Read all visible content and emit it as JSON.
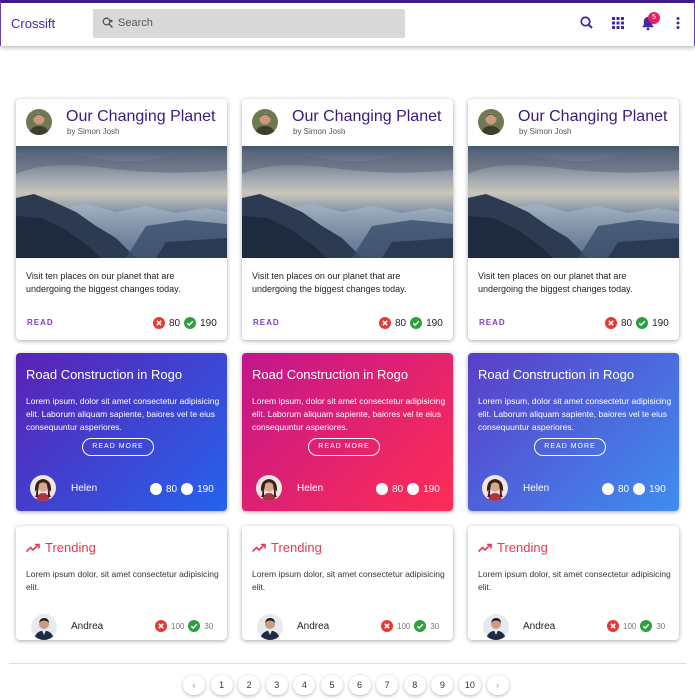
{
  "app": {
    "name": "Crossift"
  },
  "search": {
    "placeholder": "Search"
  },
  "notifications": {
    "count": "5"
  },
  "photo_cards": [
    {
      "title": "Our Changing Planet",
      "author": "by Simon Josh",
      "text": "Visit ten places on our planet that are undergoing the biggest changes today.",
      "action": "READ",
      "dislikes": "80",
      "likes": "190"
    },
    {
      "title": "Our Changing Planet",
      "author": "by Simon Josh",
      "text": "Visit ten places on our planet that are undergoing the biggest changes today.",
      "action": "READ",
      "dislikes": "80",
      "likes": "190"
    },
    {
      "title": "Our Changing Planet",
      "author": "by Simon Josh",
      "text": "Visit ten places on our planet that are undergoing the biggest changes today.",
      "action": "READ",
      "dislikes": "80",
      "likes": "190"
    }
  ],
  "gradient_cards": [
    {
      "title": "Road Construction in Rogo",
      "text": "Lorem ipsum, dolor sit amet consectetur adipisicing elit. Laborum aliquam sapiente, baiores vel te eius consequuntur asperiores.",
      "button": "READ MORE",
      "user": "Helen",
      "dislikes": "80",
      "likes": "190"
    },
    {
      "title": "Road Construction in Rogo",
      "text": "Lorem ipsum, dolor sit amet consectetur adipisicing elit. Laborum aliquam sapiente, baiores vel te eius consequuntur asperiores.",
      "button": "READ MORE",
      "user": "Helen",
      "dislikes": "80",
      "likes": "190"
    },
    {
      "title": "Road Construction in Rogo",
      "text": "Lorem ipsum, dolor sit amet consectetur adipisicing elit. Laborum aliquam sapiente, baiores vel te eius consequuntur asperiores.",
      "button": "READ MORE",
      "user": "Helen",
      "dislikes": "80",
      "likes": "190"
    }
  ],
  "trending_cards": [
    {
      "label": "Trending",
      "text": "Lorem ipsum dolor, sit amet consectetur adipisicing elit.",
      "user": "Andrea",
      "dislikes": "100",
      "likes": "30"
    },
    {
      "label": "Trending",
      "text": "Lorem ipsum dolor, sit amet consectetur adipisicing elit.",
      "user": "Andrea",
      "dislikes": "100",
      "likes": "30"
    },
    {
      "label": "Trending",
      "text": "Lorem ipsum dolor, sit amet consectetur adipisicing elit.",
      "user": "Andrea",
      "dislikes": "100",
      "likes": "30"
    }
  ],
  "pagination": {
    "prev": "‹",
    "next": "›",
    "pages": [
      "1",
      "2",
      "3",
      "4",
      "5",
      "6",
      "7",
      "8",
      "9",
      "10"
    ]
  },
  "colors": {
    "brand": "#4527a0",
    "badge": "#e91e63",
    "dislike": "#e53935",
    "like": "#2e9e3f",
    "trend": "#e53950"
  }
}
